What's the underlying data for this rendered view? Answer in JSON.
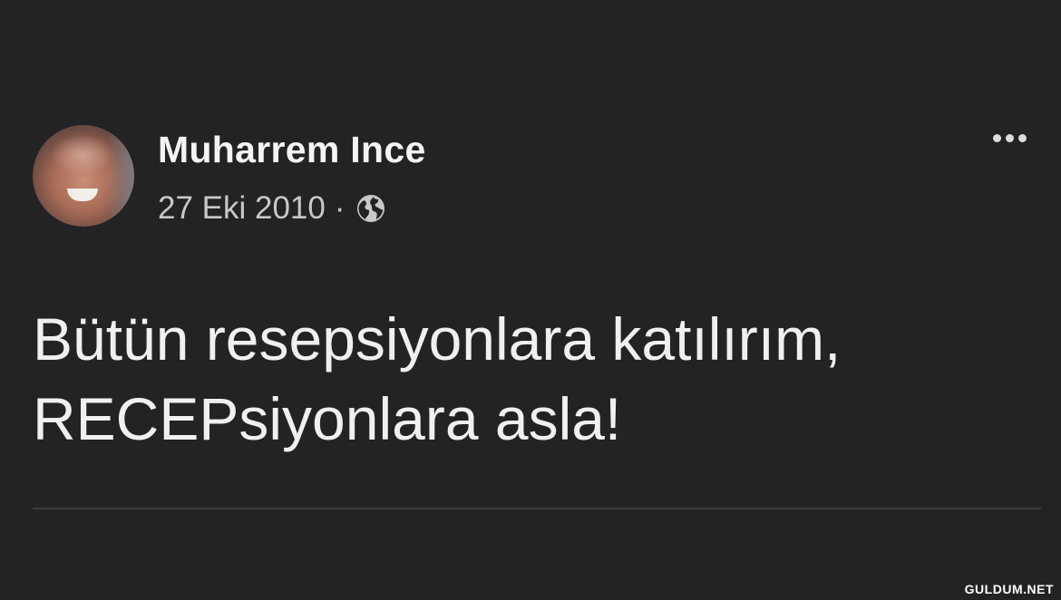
{
  "post": {
    "author": "Muharrem Ince",
    "date": "27 Eki 2010",
    "separator": "·",
    "privacy_icon": "globe-icon",
    "more_icon": "more-options-icon",
    "text_lines": [
      "Bütün resepsiyonlara katılırım,",
      "RECEPsiyonlara asla!"
    ]
  },
  "watermark": "GULDUM.NET",
  "colors": {
    "background": "#232325",
    "text": "#f0f0f0",
    "meta": "#c8c8ca",
    "divider": "#3c3c3f"
  }
}
